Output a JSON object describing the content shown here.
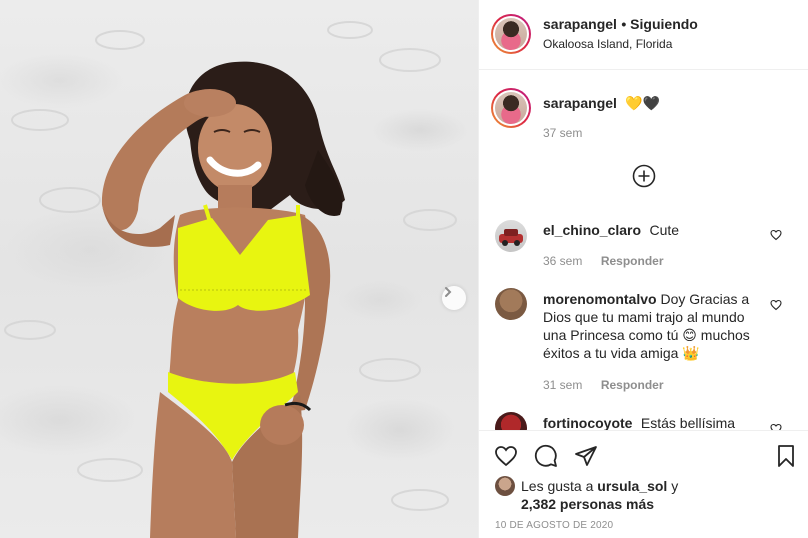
{
  "post": {
    "author": "sarapangel",
    "follow_status": "• Siguiendo",
    "location": "Okaloosa Island, Florida"
  },
  "caption": {
    "username": "sarapangel",
    "text": "💛🖤",
    "time": "37 sem"
  },
  "comments": [
    {
      "username": "el_chino_claro",
      "text": "Cute",
      "time": "36 sem",
      "reply_label": "Responder"
    },
    {
      "username": "morenomontalvo",
      "text_lines": [
        "Doy Gracias a",
        "Dios que tu mami trajo al mundo",
        "una Princesa como tú 😊 muchos",
        "éxitos a tu vida amiga 👑"
      ],
      "time": "31 sem",
      "reply_label": "Responder"
    },
    {
      "username": "fortinocoyote",
      "text": "Estás bellísima"
    }
  ],
  "likes": {
    "prefix": "Les gusta a",
    "user": "ursula_sol",
    "connector": "y",
    "others": "2,382 personas más"
  },
  "date": "10 DE AGOSTO DE 2020",
  "icons": {
    "load_more": "plus-circle-icon",
    "like": "heart-icon",
    "comment": "comment-bubble-icon",
    "share": "paper-plane-icon",
    "save": "bookmark-icon",
    "next": "chevron-right-icon"
  },
  "colors": {
    "text": "#262626",
    "muted": "#8e8e8e",
    "border": "#efefef",
    "bikini": "#e8f510"
  }
}
